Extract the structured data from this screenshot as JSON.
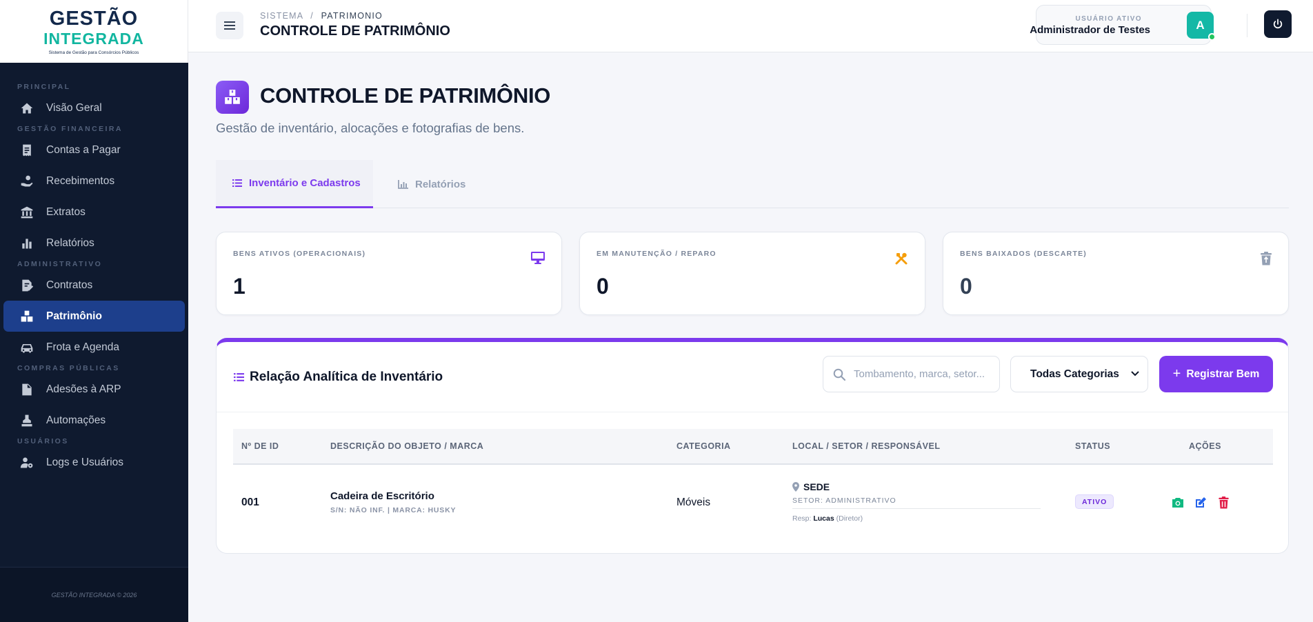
{
  "brand": {
    "line1": "GESTÃO",
    "line2": "INTEGRADA",
    "tagline": "Sistema de Gestão para Consórcios Públicos"
  },
  "sidebar": {
    "sections": {
      "principal": "PRINCIPAL",
      "financeira": "GESTÃO FINANCEIRA",
      "administrativo": "ADMINISTRATIVO",
      "compras": "COMPRAS PÚBLICAS",
      "usuarios": "USUÁRIOS"
    },
    "items": {
      "visao": "Visão Geral",
      "contas": "Contas a Pagar",
      "recebimentos": "Recebimentos",
      "extratos": "Extratos",
      "relatorios": "Relatórios",
      "contratos": "Contratos",
      "patrimonio": "Patrimônio",
      "frota": "Frota e Agenda",
      "adesoes": "Adesões à ARP",
      "automacoes": "Automações",
      "logs": "Logs e Usuários"
    },
    "footer": "GESTÃO INTEGRADA © 2026"
  },
  "topbar": {
    "crumb_root": "SISTEMA",
    "crumb_sep": "/",
    "crumb_current": "PATRIMONIO",
    "title": "CONTROLE DE PATRIMÔNIO",
    "user_role": "USUÁRIO ATIVO",
    "user_name": "Administrador de Testes",
    "avatar": "A"
  },
  "page": {
    "title": "CONTROLE DE PATRIMÔNIO",
    "subtitle": "Gestão de inventário, alocações e fotografias de bens."
  },
  "tabs": {
    "inventario": "Inventário e Cadastros",
    "relatorios": "Relatórios"
  },
  "stats": [
    {
      "label": "BENS ATIVOS (OPERACIONAIS)",
      "value": "1",
      "icon": "monitor-icon",
      "color": "#7c3aed"
    },
    {
      "label": "EM MANUTENÇÃO / REPARO",
      "value": "0",
      "icon": "tools-icon",
      "color": "#f59e0b"
    },
    {
      "label": "BENS BAIXADOS (DESCARTE)",
      "value": "0",
      "icon": "trash-icon",
      "color": "#94a0b4"
    }
  ],
  "panel": {
    "title": "Relação Analítica de Inventário",
    "search_placeholder": "Tombamento, marca, setor...",
    "category_select": "Todas Categorias",
    "register_label": "Registrar Bem"
  },
  "table": {
    "headers": {
      "id": "Nº DE ID",
      "desc": "DESCRIÇÃO DO OBJETO / MARCA",
      "cat": "CATEGORIA",
      "loc": "LOCAL / SETOR / RESPONSÁVEL",
      "status": "STATUS",
      "acoes": "AÇÕES"
    },
    "rows": [
      {
        "id": "001",
        "desc": "Cadeira de Escritório",
        "desc_sub": "S/N: NÃO INF. | MARCA: HUSKY",
        "category": "Móveis",
        "local": "SEDE",
        "setor": "SETOR: ADMINISTRATIVO",
        "resp_prefix": "Resp:",
        "resp_name": "Lucas",
        "resp_role": "(Diretor)",
        "status": "ATIVO"
      }
    ]
  },
  "colors": {
    "accent": "#7c3aed",
    "sidebar": "#0f1a2f",
    "active_nav": "#1d3f8c",
    "teal": "#14b8a6"
  }
}
